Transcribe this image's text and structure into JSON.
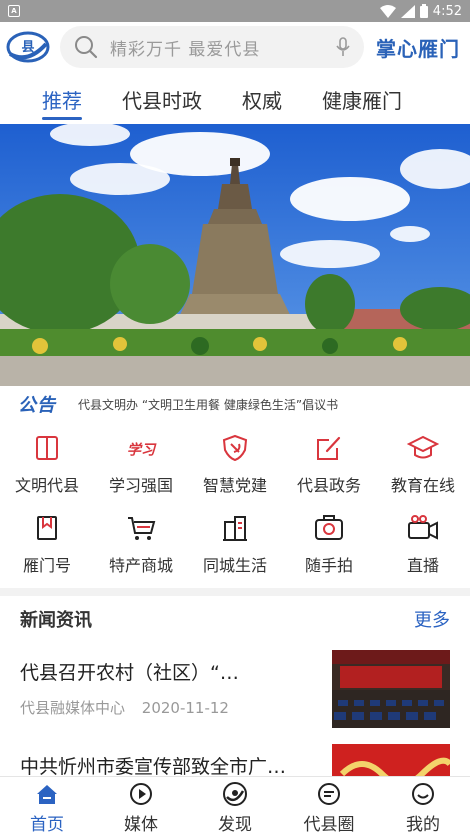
{
  "status_bar": {
    "time": "4:52",
    "app_icon_letter": "A"
  },
  "header": {
    "logo_text": "县",
    "search_placeholder": "精彩万千 最爱代县",
    "brand": "掌心雁门"
  },
  "tabs": [
    {
      "label": "推荐",
      "active": true
    },
    {
      "label": "代县时政",
      "active": false
    },
    {
      "label": "权威",
      "active": false
    },
    {
      "label": "健康雁门",
      "active": false
    }
  ],
  "notice": {
    "tag": "公告",
    "text": "代县文明办 “文明卫生用餐 健康绿色生活”倡议书"
  },
  "grid": [
    {
      "label": "文明代县",
      "icon": "book-icon"
    },
    {
      "label": "学习强国",
      "icon": "xuexi-icon"
    },
    {
      "label": "智慧党建",
      "icon": "party-shield-icon"
    },
    {
      "label": "代县政务",
      "icon": "edit-icon"
    },
    {
      "label": "教育在线",
      "icon": "graduation-cap-icon"
    },
    {
      "label": "雁门号",
      "icon": "bookmark-icon"
    },
    {
      "label": "特产商城",
      "icon": "cart-icon"
    },
    {
      "label": "同城生活",
      "icon": "buildings-icon"
    },
    {
      "label": "随手拍",
      "icon": "camera-icon"
    },
    {
      "label": "直播",
      "icon": "video-camera-icon"
    }
  ],
  "grid_icon_text": {
    "xuexi": "学习"
  },
  "news": {
    "title": "新闻资讯",
    "more": "更多",
    "items": [
      {
        "title": "代县召开农村（社区）“…",
        "source": "代县融媒体中心",
        "date": "2020-11-12"
      },
      {
        "title": "中共忻州市委宣传部致全市广…",
        "source": "",
        "date": ""
      }
    ]
  },
  "bottom_nav": [
    {
      "label": "首页",
      "icon": "home-icon",
      "active": true
    },
    {
      "label": "媒体",
      "icon": "play-icon",
      "active": false
    },
    {
      "label": "发现",
      "icon": "discover-icon",
      "active": false
    },
    {
      "label": "代县圈",
      "icon": "chat-icon",
      "active": false
    },
    {
      "label": "我的",
      "icon": "profile-icon",
      "active": false
    }
  ],
  "colors": {
    "accent": "#2b63c2",
    "icon_red": "#d9363e",
    "status_bar": "#9a9a9a"
  }
}
